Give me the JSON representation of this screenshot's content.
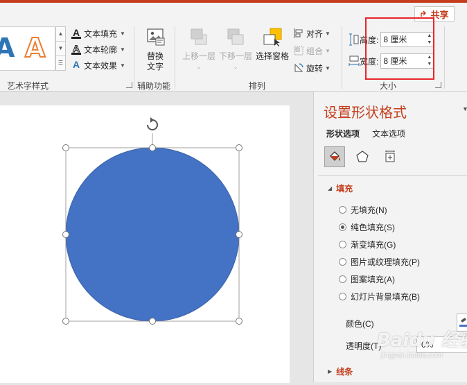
{
  "ribbon": {
    "share_label": "共享",
    "wordart": {
      "fill_label": "文本填充",
      "outline_label": "文本轮廓",
      "effect_label": "文本效果",
      "group_label": "艺术字样式",
      "gallery_letter": "A"
    },
    "accessibility": {
      "alt_text_line1": "替换",
      "alt_text_line2": "文字",
      "group_label": "辅助功能"
    },
    "arrange": {
      "bring_forward": "上移一层",
      "send_backward": "下移一层",
      "selection_pane": "选择窗格",
      "align": "对齐",
      "group": "组合",
      "rotate": "旋转",
      "group_label": "排列"
    },
    "size": {
      "height_label": "高度:",
      "height_value": "8 厘米",
      "width_label": "宽度:",
      "width_value": "8 厘米",
      "group_label": "大小"
    }
  },
  "pane": {
    "title": "设置形状格式",
    "tabs": [
      {
        "label": "形状选项",
        "active": true
      },
      {
        "label": "文本选项",
        "active": false
      }
    ],
    "fill_section": "填充",
    "fill_options": [
      {
        "label": "无填充(N)",
        "checked": false
      },
      {
        "label": "纯色填充(S)",
        "checked": true
      },
      {
        "label": "渐变填充(G)",
        "checked": false
      },
      {
        "label": "图片或纹理填充(P)",
        "checked": false
      },
      {
        "label": "图案填充(A)",
        "checked": false
      },
      {
        "label": "幻灯片背景填充(B)",
        "checked": false
      }
    ],
    "color_label": "颜色(C)",
    "transparency_label": "透明度(T)",
    "transparency_value": "0%",
    "line_section": "线条"
  },
  "shape": {
    "fill_color": "#4472c4",
    "outline_color": "#3a62a8"
  },
  "accent_color": "#c43e1c",
  "watermark": {
    "brand": "Baidu 经验",
    "url": "jingyan.baidu.com"
  }
}
